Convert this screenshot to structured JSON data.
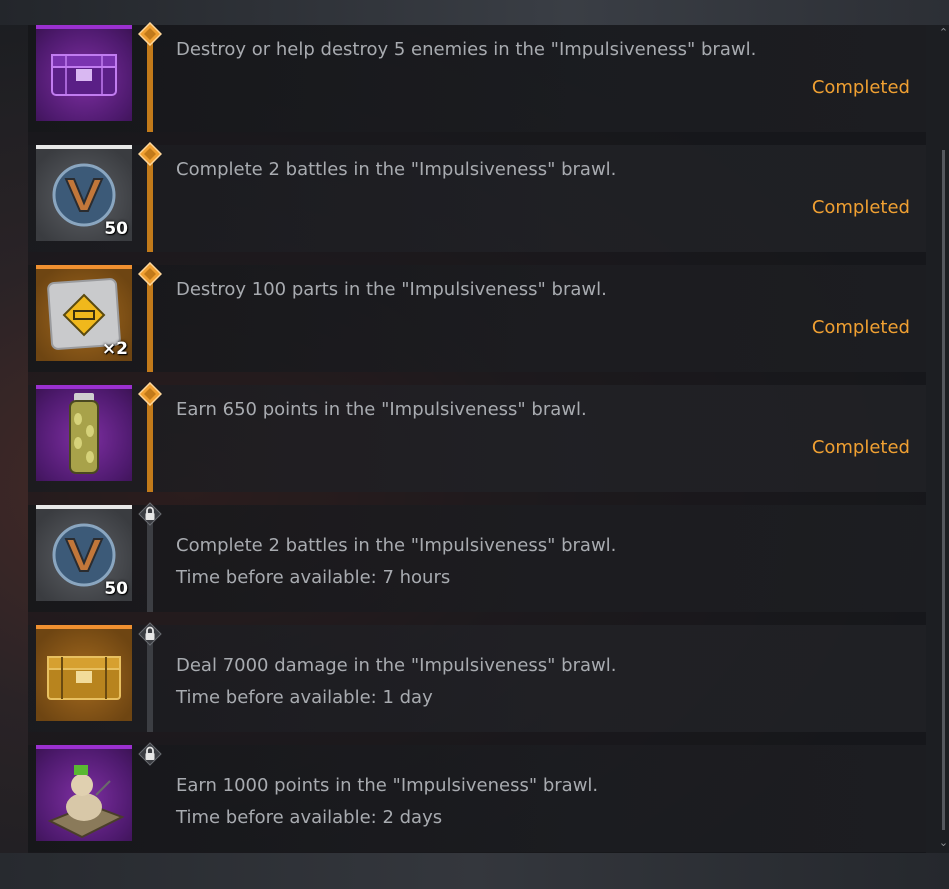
{
  "tasks": [
    {
      "description": "Destroy or help destroy 5 enemies in the \"Impulsiveness\" brawl.",
      "status": "Completed",
      "state": "completed",
      "reward": {
        "icon": "purple-crate-icon",
        "rarity_color": "#9b30d0",
        "badge": ""
      }
    },
    {
      "description": "Complete 2 battles in the \"Impulsiveness\" brawl.",
      "status": "Completed",
      "state": "completed",
      "reward": {
        "icon": "battle-pass-points-icon",
        "rarity_color": "#e8e8e8",
        "badge": "50"
      }
    },
    {
      "description": "Destroy 100 parts in the \"Impulsiveness\" brawl.",
      "status": "Completed",
      "state": "completed",
      "reward": {
        "icon": "sticker-icon",
        "rarity_color": "#f09030",
        "badge": "×2"
      }
    },
    {
      "description": "Earn 650 points in the \"Impulsiveness\" brawl.",
      "status": "Completed",
      "state": "completed",
      "reward": {
        "icon": "paint-can-icon",
        "rarity_color": "#9b30d0",
        "badge": ""
      }
    },
    {
      "description": "Complete 2 battles in the \"Impulsiveness\" brawl.",
      "status": "Time before available: 7 hours",
      "state": "locked",
      "reward": {
        "icon": "battle-pass-points-icon",
        "rarity_color": "#e8e8e8",
        "badge": "50"
      }
    },
    {
      "description": "Deal 7000 damage in the \"Impulsiveness\" brawl.",
      "status": "Time before available: 1 day",
      "state": "locked",
      "reward": {
        "icon": "gold-crate-icon",
        "rarity_color": "#f09030",
        "badge": ""
      }
    },
    {
      "description": "Earn 1000 points in the \"Impulsiveness\" brawl.",
      "status": "Time before available: 2 days",
      "state": "locked",
      "reward": {
        "icon": "figurine-decor-icon",
        "rarity_color": "#9b30d0",
        "badge": ""
      }
    }
  ],
  "colors": {
    "completed_accent": "#f0a032",
    "track_completed": "#c27a1a",
    "track_locked": "#3c3e43",
    "text": "#a8abb0"
  },
  "icons": {
    "completed_marker": "diamond-icon",
    "locked_marker": "padlock-icon",
    "scroll_up": "chevron-up-icon",
    "scroll_down": "chevron-down-icon"
  }
}
